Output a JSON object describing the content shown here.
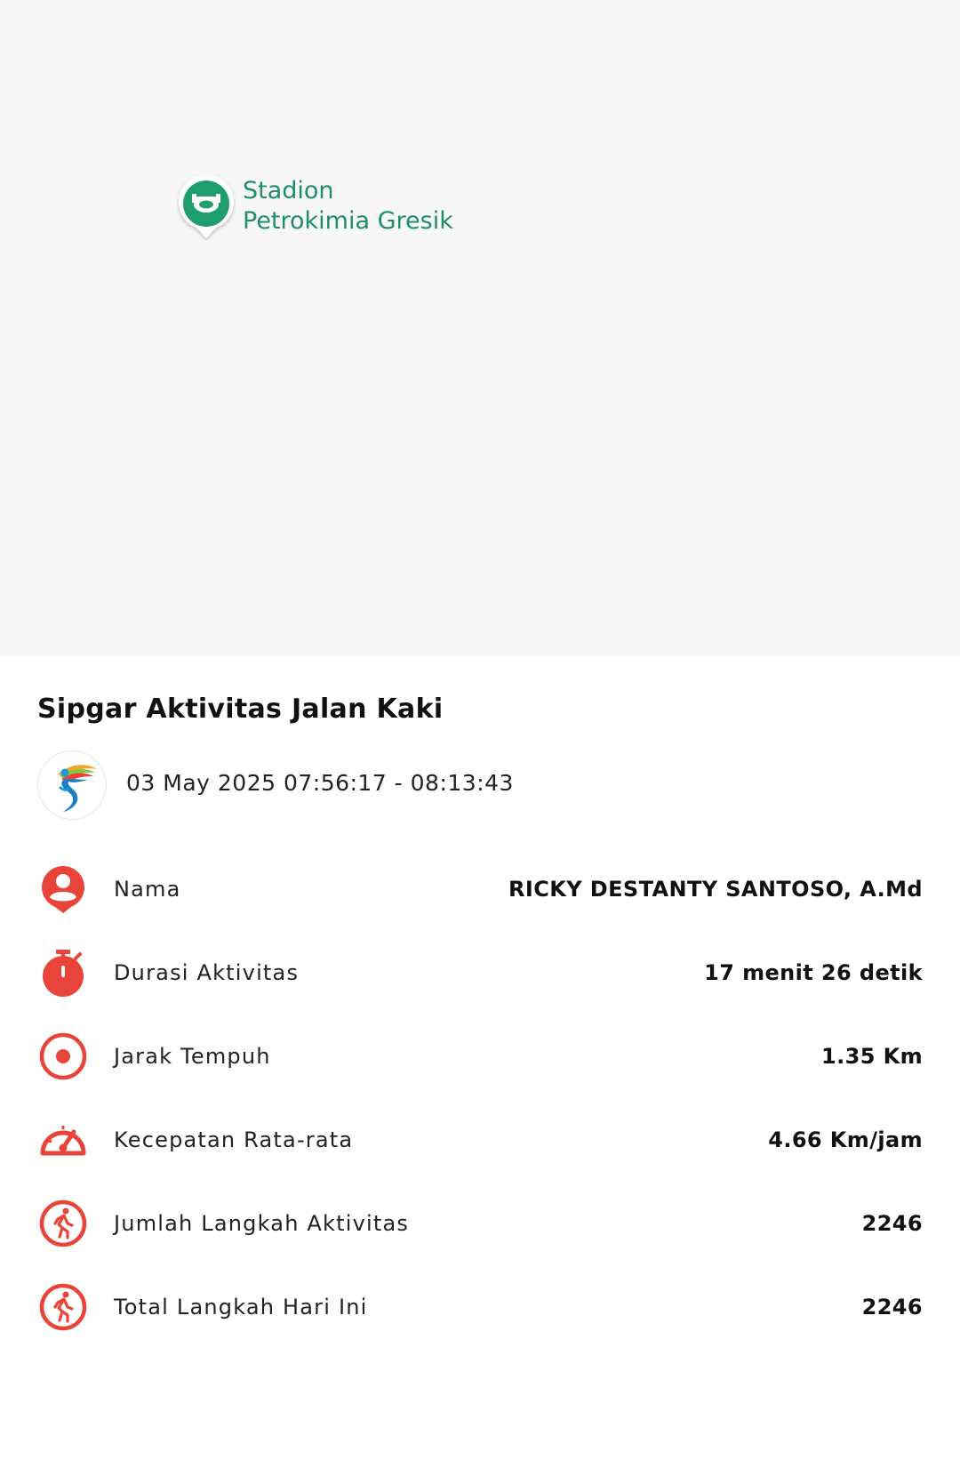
{
  "map": {
    "poi": {
      "line1": "Stadion",
      "line2": "Petrokimia Gresik",
      "icon": "stadium-pin-icon"
    }
  },
  "activity": {
    "title": "Sipgar Aktivitas Jalan Kaki",
    "date_range": "03 May 2025 07:56:17 - 08:13:43",
    "logo_icon": "sipgar-logo"
  },
  "stats": [
    {
      "icon": "person-pin-icon",
      "label": "Nama",
      "value": "RICKY DESTANTY SANTOSO, A.Md"
    },
    {
      "icon": "stopwatch-icon",
      "label": "Durasi Aktivitas",
      "value": "17 menit 26 detik"
    },
    {
      "icon": "target-icon",
      "label": "Jarak Tempuh",
      "value": "1.35 Km"
    },
    {
      "icon": "speedometer-icon",
      "label": "Kecepatan Rata-rata",
      "value": "4.66 Km/jam"
    },
    {
      "icon": "walking-icon",
      "label": "Jumlah Langkah Aktivitas",
      "value": "2246"
    },
    {
      "icon": "walking-icon",
      "label": "Total Langkah Hari Ini",
      "value": "2246"
    }
  ],
  "colors": {
    "accent": "#e8443a",
    "poi_green": "#1f8f6a",
    "map_bg": "#f7f7f7"
  }
}
